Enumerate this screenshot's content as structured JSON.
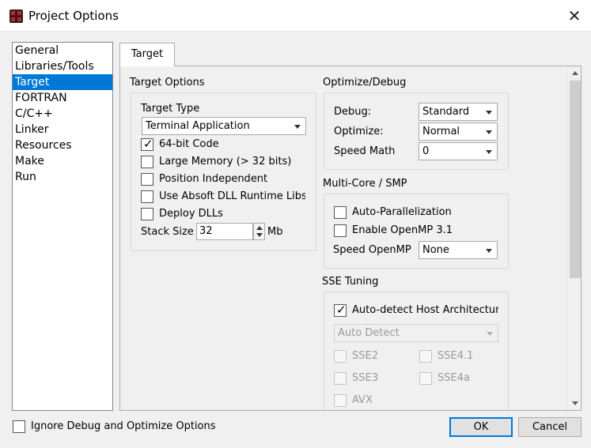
{
  "window": {
    "title": "Project Options",
    "close_glyph": "✕"
  },
  "categories": [
    "General",
    "Libraries/Tools",
    "Target",
    "FORTRAN",
    "C/C++",
    "Linker",
    "Resources",
    "Make",
    "Run"
  ],
  "selected_category": "Target",
  "tab": {
    "label": "Target"
  },
  "target_options": {
    "section_label": "Target Options",
    "target_type_label": "Target Type",
    "target_type_value": "Terminal Application",
    "checks": [
      {
        "label": "64-bit Code",
        "checked": true
      },
      {
        "label": "Large Memory (> 32 bits)",
        "checked": false
      },
      {
        "label": "Position Independent",
        "checked": false
      },
      {
        "label": "Use Absoft DLL Runtime Libs",
        "checked": false
      },
      {
        "label": "Deploy DLLs",
        "checked": false
      }
    ],
    "stack_size_label": "Stack Size",
    "stack_size_value": "32",
    "stack_size_unit": "Mb"
  },
  "optimize_debug": {
    "section_label": "Optimize/Debug",
    "debug_label": "Debug:",
    "debug_value": "Standard",
    "optimize_label": "Optimize:",
    "optimize_value": "Normal",
    "speed_math_label": "Speed Math",
    "speed_math_value": "0"
  },
  "multicore": {
    "section_label": "Multi-Core / SMP",
    "auto_parallel_label": "Auto-Parallelization",
    "openmp_label": "Enable OpenMP 3.1",
    "speed_openmp_label": "Speed OpenMP",
    "speed_openmp_value": "None"
  },
  "sse": {
    "section_label": "SSE Tuning",
    "autodetect_label": "Auto-detect Host Architecture",
    "autodetect_checked": true,
    "mode_value": "Auto Detect",
    "options": [
      "SSE2",
      "SSE4.1",
      "SSE3",
      "SSE4a",
      "AVX"
    ]
  },
  "footer": {
    "ignore_label": "Ignore Debug and Optimize Options",
    "ok_label": "OK",
    "cancel_label": "Cancel"
  },
  "colors": {
    "selection": "#0078d7",
    "app_icon": "#d21f1f"
  }
}
